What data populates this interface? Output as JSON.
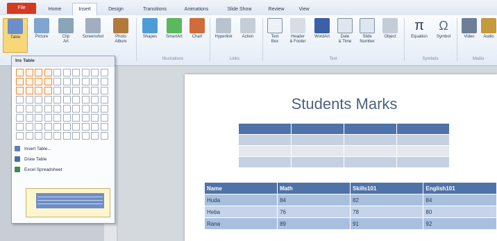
{
  "ribbon_tabs": [
    "File",
    "Home",
    "Insert",
    "Design",
    "Transitions",
    "Animations",
    "Slide Show",
    "Review",
    "View"
  ],
  "ribbon_buttons": [
    {
      "label": "Table"
    },
    {
      "label": "Picture"
    },
    {
      "label": "Clip\nArt"
    },
    {
      "label": "Screenshot"
    },
    {
      "label": "Photo\nAlbum"
    },
    {
      "label": "Shapes"
    },
    {
      "label": "SmartArt"
    },
    {
      "label": "Chart"
    },
    {
      "label": "Hyperlink"
    },
    {
      "label": "Action"
    },
    {
      "label": "Text\nBox"
    },
    {
      "label": "Header\n& Footer"
    },
    {
      "label": "WordArt"
    },
    {
      "label": "Date\n& Time"
    },
    {
      "label": "Slide\nNumber"
    },
    {
      "label": "Object"
    },
    {
      "label": "Equation"
    },
    {
      "label": "Symbol"
    },
    {
      "label": "Video"
    },
    {
      "label": "Audio"
    }
  ],
  "ribbon_groups": [
    "Illustrations",
    "Links",
    "Text",
    "Symbols",
    "Media"
  ],
  "dropdown": {
    "header": "Ins Table",
    "items": [
      "Insert Table...",
      "Draw Table",
      "Excel Spreadsheet"
    ]
  },
  "slide": {
    "title": "Students Marks",
    "table": {
      "headers": [
        "Name",
        "Math",
        "Skills101",
        "English101"
      ],
      "rows": [
        [
          "Huda",
          "84",
          "82",
          "84"
        ],
        [
          "Heba",
          "76",
          "78",
          "80"
        ],
        [
          "Rana",
          "89",
          "91",
          "92"
        ]
      ]
    }
  },
  "colors": {
    "file_tab": "#d33a20",
    "slide_title": "#4a6280",
    "table_header": "#4f73a8",
    "table_row": "#a9bfdf",
    "table_row_alt": "#c5d4ea"
  }
}
